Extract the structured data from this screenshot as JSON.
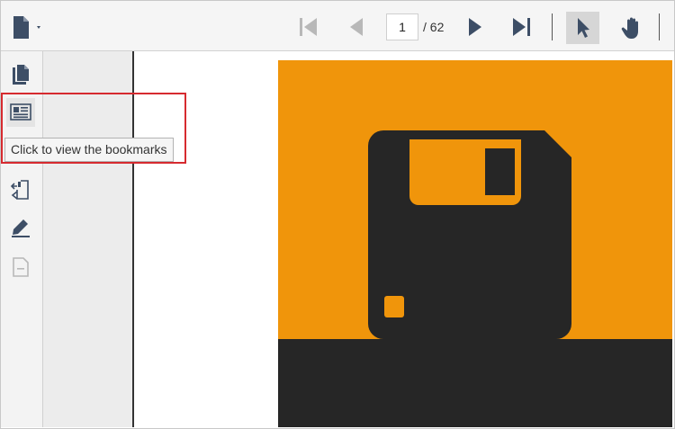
{
  "toolbar": {
    "file_menu_icon": "file-icon",
    "navigation": {
      "first_icon": "first-page-icon",
      "prev_icon": "previous-page-icon",
      "current_page": "1",
      "total_pages": "/ 62",
      "next_icon": "next-page-icon",
      "last_icon": "last-page-icon"
    },
    "tools": {
      "select_icon": "cursor-icon",
      "pan_icon": "hand-icon",
      "selected": "select"
    }
  },
  "sidebar": {
    "items": [
      {
        "name": "page-thumbnails",
        "icon": "pages-icon"
      },
      {
        "name": "bookmarks",
        "icon": "bookmark-panel-icon"
      },
      {
        "name": "redaction",
        "icon": "redact-icon"
      },
      {
        "name": "signature",
        "icon": "pen-icon"
      },
      {
        "name": "form-designer",
        "icon": "form-icon",
        "disabled": true
      }
    ]
  },
  "tooltip": {
    "text": "Click to view the bookmarks"
  },
  "colors": {
    "accent_highlight": "#d62a2f",
    "page_orange": "#f0950b",
    "page_dark": "#262626",
    "icon_blue": "#3d4e66",
    "icon_disabled": "#b8b8b8"
  }
}
